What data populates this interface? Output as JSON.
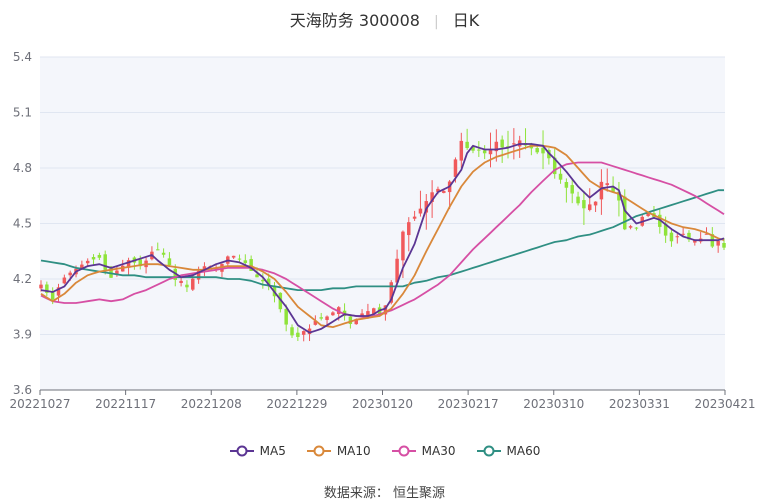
{
  "header": {
    "stock_name": "天海防务 300008",
    "period": "日K"
  },
  "footer": {
    "source": "数据来源： 恒生聚源"
  },
  "colors": {
    "up": "#f0595b",
    "down": "#8fe33a",
    "ma5": "#5b3593",
    "ma10": "#d9883a",
    "ma30": "#d64fa4",
    "ma60": "#2f8f83",
    "grid": "#e0e6f1",
    "plot_bg": "#f4f6fb"
  },
  "chart_data": {
    "type": "candlestick",
    "ylim": [
      3.6,
      5.4
    ],
    "y_ticks": [
      "3.6",
      "3.9",
      "4.2",
      "4.5",
      "4.8",
      "5.1",
      "5.4"
    ],
    "x_ticks": [
      "20221027",
      "20221117",
      "20221208",
      "20221229",
      "20230120",
      "20230217",
      "20230310",
      "20230331",
      "20230421"
    ],
    "legend": [
      "MA5",
      "MA10",
      "MA30",
      "MA60"
    ],
    "days": 118,
    "close_knots": [
      [
        0,
        4.17
      ],
      [
        2,
        4.09
      ],
      [
        4,
        4.21
      ],
      [
        7,
        4.28
      ],
      [
        10,
        4.3
      ],
      [
        12,
        4.22
      ],
      [
        15,
        4.31
      ],
      [
        17,
        4.27
      ],
      [
        19,
        4.35
      ],
      [
        21,
        4.34
      ],
      [
        23,
        4.2
      ],
      [
        25,
        4.17
      ],
      [
        27,
        4.25
      ],
      [
        30,
        4.27
      ],
      [
        32,
        4.32
      ],
      [
        34,
        4.31
      ],
      [
        36,
        4.25
      ],
      [
        38,
        4.18
      ],
      [
        40,
        4.12
      ],
      [
        41,
        4.03
      ],
      [
        42,
        3.96
      ],
      [
        43,
        3.9
      ],
      [
        44,
        3.89
      ],
      [
        45,
        3.91
      ],
      [
        47,
        3.96
      ],
      [
        49,
        4.0
      ],
      [
        51,
        4.04
      ],
      [
        53,
        3.97
      ],
      [
        55,
        4.02
      ],
      [
        57,
        4.05
      ],
      [
        58,
        4.01
      ],
      [
        59,
        4.07
      ],
      [
        60,
        4.18
      ],
      [
        61,
        4.32
      ],
      [
        62,
        4.45
      ],
      [
        64,
        4.54
      ],
      [
        66,
        4.61
      ],
      [
        68,
        4.7
      ],
      [
        69,
        4.67
      ],
      [
        70,
        4.73
      ],
      [
        71,
        4.86
      ],
      [
        72,
        4.94
      ],
      [
        74,
        4.9
      ],
      [
        76,
        4.88
      ],
      [
        78,
        4.93
      ],
      [
        80,
        4.9
      ],
      [
        82,
        4.95
      ],
      [
        84,
        4.91
      ],
      [
        86,
        4.87
      ],
      [
        87,
        4.85
      ],
      [
        88,
        4.78
      ],
      [
        90,
        4.68
      ],
      [
        92,
        4.62
      ],
      [
        93,
        4.57
      ],
      [
        95,
        4.62
      ],
      [
        96,
        4.74
      ],
      [
        97,
        4.71
      ],
      [
        99,
        4.61
      ],
      [
        100,
        4.46
      ],
      [
        102,
        4.49
      ],
      [
        104,
        4.56
      ],
      [
        105,
        4.54
      ],
      [
        106,
        4.47
      ],
      [
        108,
        4.41
      ],
      [
        110,
        4.43
      ],
      [
        112,
        4.4
      ],
      [
        114,
        4.44
      ],
      [
        115,
        4.37
      ],
      [
        116,
        4.42
      ],
      [
        117,
        4.36
      ]
    ],
    "ma5": [
      [
        0,
        4.14
      ],
      [
        2,
        4.13
      ],
      [
        4,
        4.16
      ],
      [
        6,
        4.24
      ],
      [
        8,
        4.27
      ],
      [
        10,
        4.28
      ],
      [
        12,
        4.26
      ],
      [
        14,
        4.28
      ],
      [
        16,
        4.3
      ],
      [
        17,
        4.31
      ],
      [
        18,
        4.32
      ],
      [
        19,
        4.33
      ],
      [
        20,
        4.3
      ],
      [
        22,
        4.25
      ],
      [
        24,
        4.21
      ],
      [
        26,
        4.22
      ],
      [
        28,
        4.25
      ],
      [
        30,
        4.28
      ],
      [
        32,
        4.3
      ],
      [
        34,
        4.29
      ],
      [
        36,
        4.26
      ],
      [
        38,
        4.21
      ],
      [
        40,
        4.13
      ],
      [
        42,
        4.05
      ],
      [
        44,
        3.95
      ],
      [
        46,
        3.91
      ],
      [
        48,
        3.93
      ],
      [
        50,
        3.97
      ],
      [
        52,
        4.01
      ],
      [
        54,
        4.0
      ],
      [
        56,
        4.0
      ],
      [
        57,
        4.01
      ],
      [
        58,
        4.03
      ],
      [
        59,
        4.04
      ],
      [
        60,
        4.09
      ],
      [
        62,
        4.26
      ],
      [
        64,
        4.39
      ],
      [
        66,
        4.58
      ],
      [
        68,
        4.67
      ],
      [
        70,
        4.7
      ],
      [
        72,
        4.79
      ],
      [
        73,
        4.88
      ],
      [
        74,
        4.92
      ],
      [
        76,
        4.9
      ],
      [
        78,
        4.9
      ],
      [
        80,
        4.91
      ],
      [
        82,
        4.93
      ],
      [
        84,
        4.93
      ],
      [
        86,
        4.92
      ],
      [
        87,
        4.88
      ],
      [
        88,
        4.85
      ],
      [
        90,
        4.78
      ],
      [
        92,
        4.7
      ],
      [
        94,
        4.64
      ],
      [
        96,
        4.69
      ],
      [
        98,
        4.7
      ],
      [
        99,
        4.68
      ],
      [
        100,
        4.57
      ],
      [
        102,
        4.5
      ],
      [
        104,
        4.52
      ],
      [
        105,
        4.53
      ],
      [
        106,
        4.52
      ],
      [
        108,
        4.47
      ],
      [
        110,
        4.43
      ],
      [
        112,
        4.41
      ],
      [
        114,
        4.41
      ],
      [
        116,
        4.41
      ],
      [
        117,
        4.42
      ]
    ],
    "ma10": [
      [
        0,
        4.12
      ],
      [
        2,
        4.08
      ],
      [
        4,
        4.12
      ],
      [
        6,
        4.18
      ],
      [
        8,
        4.22
      ],
      [
        10,
        4.24
      ],
      [
        12,
        4.25
      ],
      [
        14,
        4.26
      ],
      [
        16,
        4.27
      ],
      [
        18,
        4.28
      ],
      [
        20,
        4.28
      ],
      [
        22,
        4.27
      ],
      [
        24,
        4.26
      ],
      [
        26,
        4.25
      ],
      [
        28,
        4.25
      ],
      [
        30,
        4.26
      ],
      [
        32,
        4.27
      ],
      [
        34,
        4.27
      ],
      [
        36,
        4.27
      ],
      [
        38,
        4.24
      ],
      [
        40,
        4.2
      ],
      [
        42,
        4.13
      ],
      [
        44,
        4.05
      ],
      [
        46,
        4.0
      ],
      [
        48,
        3.95
      ],
      [
        50,
        3.94
      ],
      [
        52,
        3.96
      ],
      [
        54,
        3.98
      ],
      [
        56,
        3.99
      ],
      [
        58,
        4.0
      ],
      [
        60,
        4.04
      ],
      [
        62,
        4.12
      ],
      [
        64,
        4.22
      ],
      [
        66,
        4.35
      ],
      [
        68,
        4.47
      ],
      [
        70,
        4.59
      ],
      [
        72,
        4.7
      ],
      [
        74,
        4.78
      ],
      [
        76,
        4.83
      ],
      [
        78,
        4.86
      ],
      [
        80,
        4.88
      ],
      [
        82,
        4.9
      ],
      [
        84,
        4.92
      ],
      [
        86,
        4.92
      ],
      [
        88,
        4.91
      ],
      [
        90,
        4.87
      ],
      [
        92,
        4.8
      ],
      [
        94,
        4.73
      ],
      [
        96,
        4.69
      ],
      [
        98,
        4.67
      ],
      [
        99,
        4.66
      ],
      [
        100,
        4.64
      ],
      [
        102,
        4.6
      ],
      [
        104,
        4.56
      ],
      [
        106,
        4.53
      ],
      [
        108,
        4.5
      ],
      [
        110,
        4.48
      ],
      [
        112,
        4.47
      ],
      [
        114,
        4.45
      ],
      [
        116,
        4.42
      ],
      [
        117,
        4.41
      ]
    ],
    "ma30": [
      [
        0,
        4.11
      ],
      [
        2,
        4.08
      ],
      [
        4,
        4.07
      ],
      [
        6,
        4.07
      ],
      [
        8,
        4.08
      ],
      [
        10,
        4.09
      ],
      [
        12,
        4.08
      ],
      [
        14,
        4.09
      ],
      [
        16,
        4.12
      ],
      [
        18,
        4.14
      ],
      [
        20,
        4.17
      ],
      [
        22,
        4.2
      ],
      [
        24,
        4.22
      ],
      [
        26,
        4.23
      ],
      [
        28,
        4.24
      ],
      [
        30,
        4.25
      ],
      [
        32,
        4.26
      ],
      [
        34,
        4.26
      ],
      [
        36,
        4.26
      ],
      [
        38,
        4.25
      ],
      [
        40,
        4.23
      ],
      [
        42,
        4.2
      ],
      [
        44,
        4.16
      ],
      [
        46,
        4.12
      ],
      [
        48,
        4.08
      ],
      [
        50,
        4.04
      ],
      [
        52,
        4.01
      ],
      [
        54,
        4.0
      ],
      [
        56,
        3.99
      ],
      [
        58,
        4.01
      ],
      [
        60,
        4.03
      ],
      [
        62,
        4.06
      ],
      [
        64,
        4.09
      ],
      [
        66,
        4.13
      ],
      [
        68,
        4.17
      ],
      [
        70,
        4.22
      ],
      [
        72,
        4.29
      ],
      [
        74,
        4.36
      ],
      [
        76,
        4.42
      ],
      [
        78,
        4.48
      ],
      [
        80,
        4.54
      ],
      [
        82,
        4.6
      ],
      [
        84,
        4.67
      ],
      [
        86,
        4.73
      ],
      [
        88,
        4.79
      ],
      [
        90,
        4.82
      ],
      [
        92,
        4.83
      ],
      [
        94,
        4.83
      ],
      [
        96,
        4.83
      ],
      [
        98,
        4.81
      ],
      [
        100,
        4.79
      ],
      [
        102,
        4.77
      ],
      [
        104,
        4.75
      ],
      [
        106,
        4.73
      ],
      [
        108,
        4.71
      ],
      [
        110,
        4.68
      ],
      [
        112,
        4.65
      ],
      [
        114,
        4.61
      ],
      [
        116,
        4.57
      ],
      [
        117,
        4.55
      ]
    ],
    "ma60": [
      [
        0,
        4.3
      ],
      [
        2,
        4.29
      ],
      [
        4,
        4.28
      ],
      [
        6,
        4.26
      ],
      [
        8,
        4.25
      ],
      [
        10,
        4.24
      ],
      [
        12,
        4.23
      ],
      [
        14,
        4.22
      ],
      [
        16,
        4.22
      ],
      [
        18,
        4.21
      ],
      [
        20,
        4.21
      ],
      [
        22,
        4.21
      ],
      [
        24,
        4.21
      ],
      [
        26,
        4.21
      ],
      [
        28,
        4.21
      ],
      [
        30,
        4.21
      ],
      [
        32,
        4.2
      ],
      [
        34,
        4.2
      ],
      [
        36,
        4.19
      ],
      [
        38,
        4.17
      ],
      [
        40,
        4.16
      ],
      [
        42,
        4.15
      ],
      [
        44,
        4.14
      ],
      [
        46,
        4.14
      ],
      [
        48,
        4.14
      ],
      [
        50,
        4.15
      ],
      [
        52,
        4.15
      ],
      [
        54,
        4.16
      ],
      [
        56,
        4.16
      ],
      [
        58,
        4.16
      ],
      [
        60,
        4.16
      ],
      [
        62,
        4.16
      ],
      [
        64,
        4.18
      ],
      [
        66,
        4.19
      ],
      [
        68,
        4.21
      ],
      [
        70,
        4.22
      ],
      [
        72,
        4.24
      ],
      [
        74,
        4.26
      ],
      [
        76,
        4.28
      ],
      [
        78,
        4.3
      ],
      [
        80,
        4.32
      ],
      [
        82,
        4.34
      ],
      [
        84,
        4.36
      ],
      [
        86,
        4.38
      ],
      [
        88,
        4.4
      ],
      [
        90,
        4.41
      ],
      [
        92,
        4.43
      ],
      [
        94,
        4.44
      ],
      [
        96,
        4.46
      ],
      [
        98,
        4.48
      ],
      [
        100,
        4.51
      ],
      [
        102,
        4.54
      ],
      [
        104,
        4.56
      ],
      [
        106,
        4.58
      ],
      [
        108,
        4.6
      ],
      [
        110,
        4.62
      ],
      [
        112,
        4.64
      ],
      [
        114,
        4.66
      ],
      [
        116,
        4.68
      ],
      [
        117,
        4.68
      ]
    ]
  }
}
